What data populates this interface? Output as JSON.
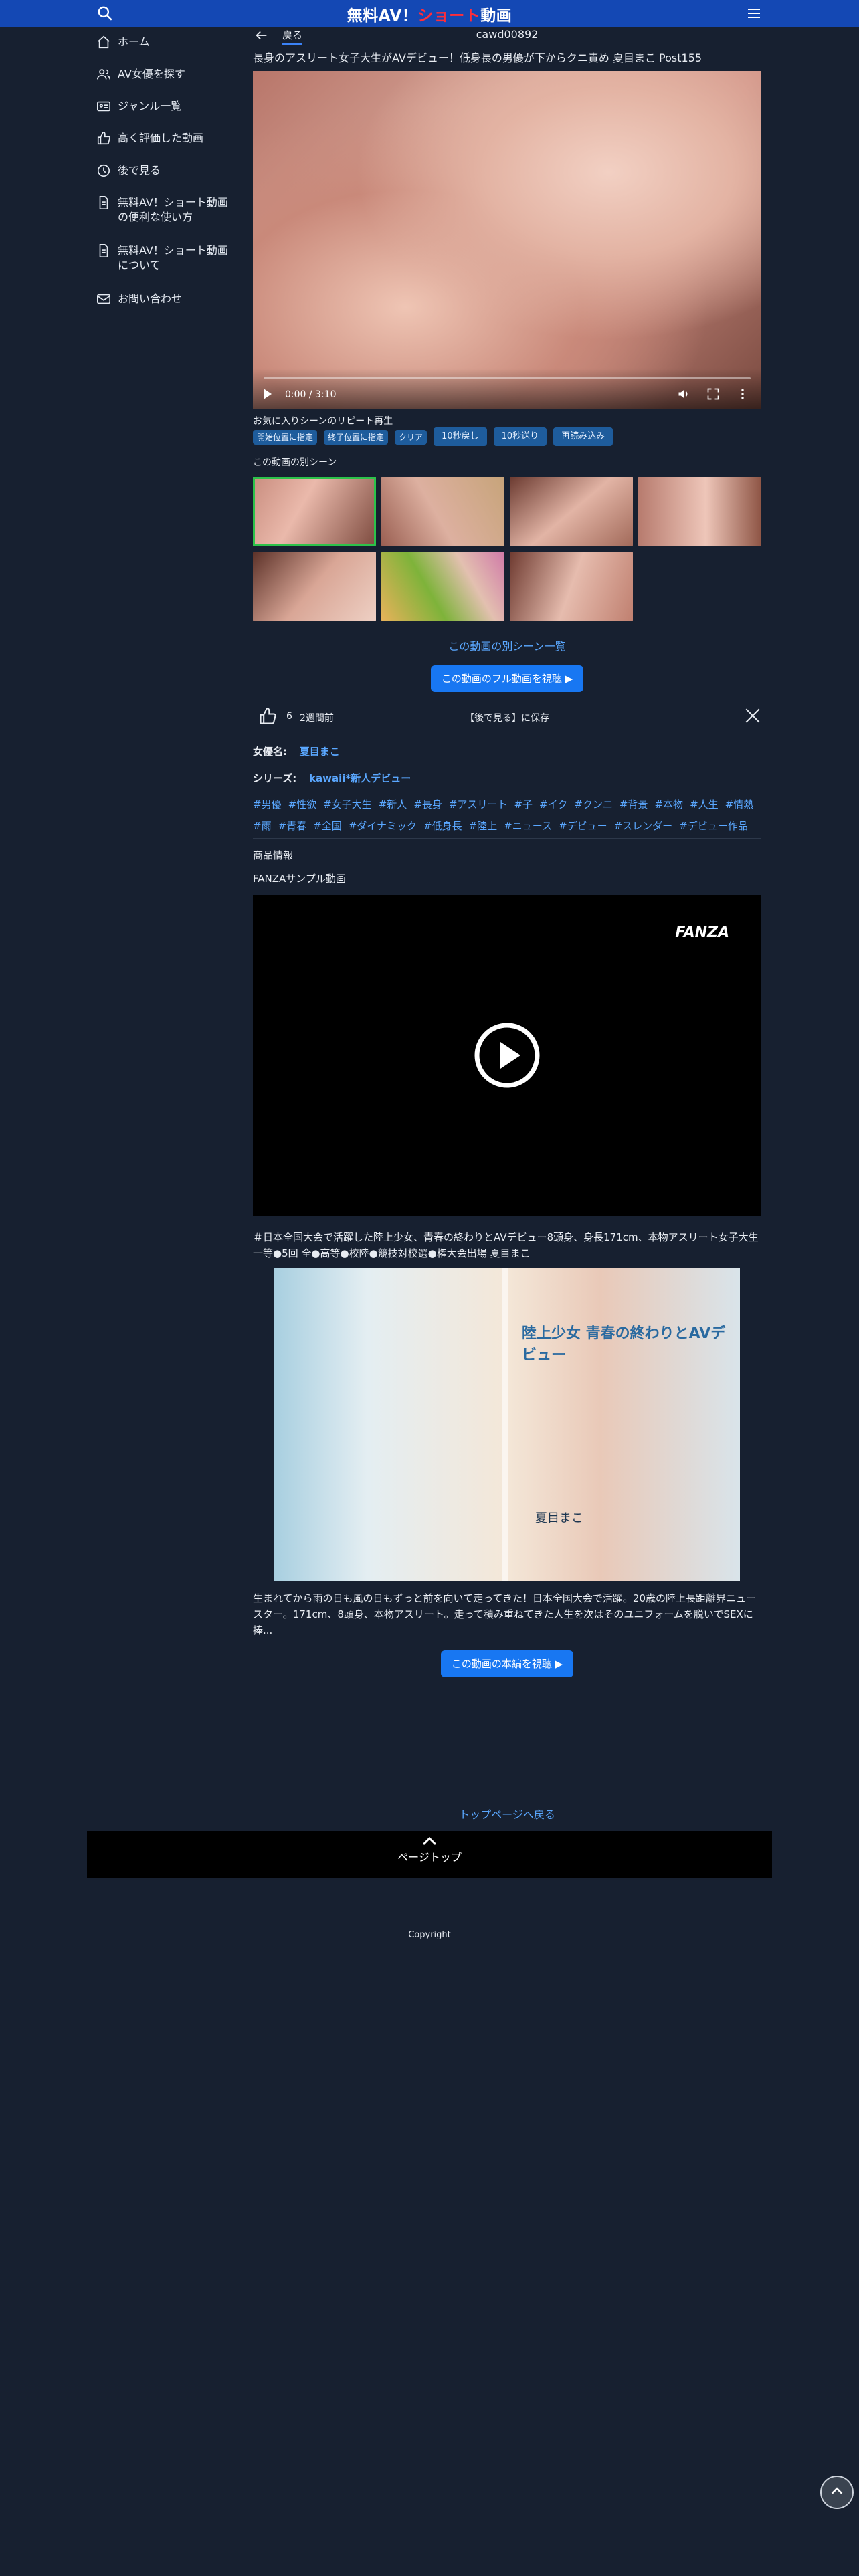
{
  "header": {
    "logo_part1": "無料AV！",
    "logo_part2": "ショート",
    "logo_part3": "動画"
  },
  "sidebar": {
    "items": [
      {
        "label": "ホーム",
        "icon": "home-icon"
      },
      {
        "label": "AV女優を探す",
        "icon": "users-icon"
      },
      {
        "label": "ジャンル一覧",
        "icon": "id-card-icon"
      },
      {
        "label": "高く評価した動画",
        "icon": "thumbs-up-icon"
      },
      {
        "label": "後で見る",
        "icon": "clock-icon"
      },
      {
        "label": "無料AV！ショート動画の便利な使い方",
        "icon": "document-icon"
      },
      {
        "label": "無料AV！ショート動画について",
        "icon": "document-icon"
      },
      {
        "label": "お問い合わせ",
        "icon": "mail-icon"
      }
    ]
  },
  "main": {
    "back_label": "戻る",
    "code": "cawd00892",
    "title": "長身のアスリート女子大生がAVデビュー！低身長の男優が下からクニ責め 夏目まこ Post155",
    "player": {
      "time": "0:00 / 3:10"
    },
    "repeat_label": "お気に入りシーンのリピート再生",
    "repeat_buttons": [
      "開始位置に指定",
      "終了位置に指定",
      "クリア"
    ],
    "seek_buttons": [
      "10秒戻し",
      "10秒送り",
      "再読み込み"
    ],
    "other_scenes_label": "この動画の別シーン",
    "other_scenes_link": "この動画の別シーン一覧",
    "full_video_button": "この動画のフル動画を視聴 ▶",
    "likes": "6",
    "posted_ago": "2週間前",
    "watch_later": "【後で見る】に保存",
    "actress_key": "女優名:",
    "actress_value": "夏目まこ",
    "series_key": "シリーズ:",
    "series_value": "kawaii*新人デビュー",
    "tags": [
      "#男優",
      "#性欲",
      "#女子大生",
      "#新人",
      "#長身",
      "#アスリート",
      "#子",
      "#イク",
      "#クンニ",
      "#背景",
      "#本物",
      "#人生",
      "#情熱",
      "#雨",
      "#青春",
      "#全国",
      "#ダイナミック",
      "#低身長",
      "#陸上",
      "#ニュース",
      "#デビュー",
      "#スレンダー",
      "#デビュー作品"
    ],
    "product_info": "商品情報",
    "fanza_sample": "FANZAサンプル動画",
    "fanza_logo": "FANZA",
    "description_1": "＃日本全国大会で活躍した陸上少女、青春の終わりとAVデビュー8頭身、身長171cm、本物アスリート女子大生一等●5回 全●高等●校陸●競技対校選●権大会出場 夏目まこ",
    "cover_text": "陸上少女 青春の終わりとAVデビュー",
    "cover_name": "夏目まこ",
    "description_2": "生まれてから雨の日も風の日もずっと前を向いて走ってきた！日本全国大会で活躍。20歳の陸上長距離界ニュースター。171cm、8頭身、本物アスリート。走って積み重ねてきた人生を次はそのユニフォームを脱いでSEXに捧...",
    "main_video_button": "この動画の本編を視聴 ▶"
  },
  "footer": {
    "top_link": "トップページへ戻る",
    "page_top": "ページトップ",
    "copyright": "Copyright"
  }
}
